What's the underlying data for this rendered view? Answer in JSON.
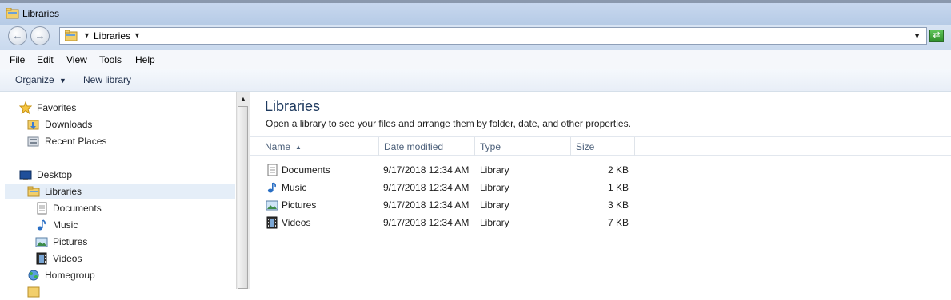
{
  "window": {
    "title": "Libraries"
  },
  "address": {
    "crumb": "Libraries"
  },
  "menu": [
    "File",
    "Edit",
    "View",
    "Tools",
    "Help"
  ],
  "toolbar": {
    "organize": "Organize",
    "new_library": "New library"
  },
  "nav": {
    "favorites": "Favorites",
    "downloads": "Downloads",
    "recent": "Recent Places",
    "desktop": "Desktop",
    "libraries": "Libraries",
    "documents": "Documents",
    "music": "Music",
    "pictures": "Pictures",
    "videos": "Videos",
    "homegroup": "Homegroup"
  },
  "content": {
    "title": "Libraries",
    "subtitle": "Open a library to see your files and arrange them by folder, date, and other properties.",
    "columns": {
      "name": "Name",
      "date": "Date modified",
      "type": "Type",
      "size": "Size"
    },
    "rows": [
      {
        "name": "Documents",
        "date": "9/17/2018 12:34 AM",
        "type": "Library",
        "size": "2 KB",
        "icon": "document-library-icon"
      },
      {
        "name": "Music",
        "date": "9/17/2018 12:34 AM",
        "type": "Library",
        "size": "1 KB",
        "icon": "music-note-icon"
      },
      {
        "name": "Pictures",
        "date": "9/17/2018 12:34 AM",
        "type": "Library",
        "size": "3 KB",
        "icon": "picture-icon"
      },
      {
        "name": "Videos",
        "date": "9/17/2018 12:34 AM",
        "type": "Library",
        "size": "7 KB",
        "icon": "film-icon"
      }
    ]
  }
}
